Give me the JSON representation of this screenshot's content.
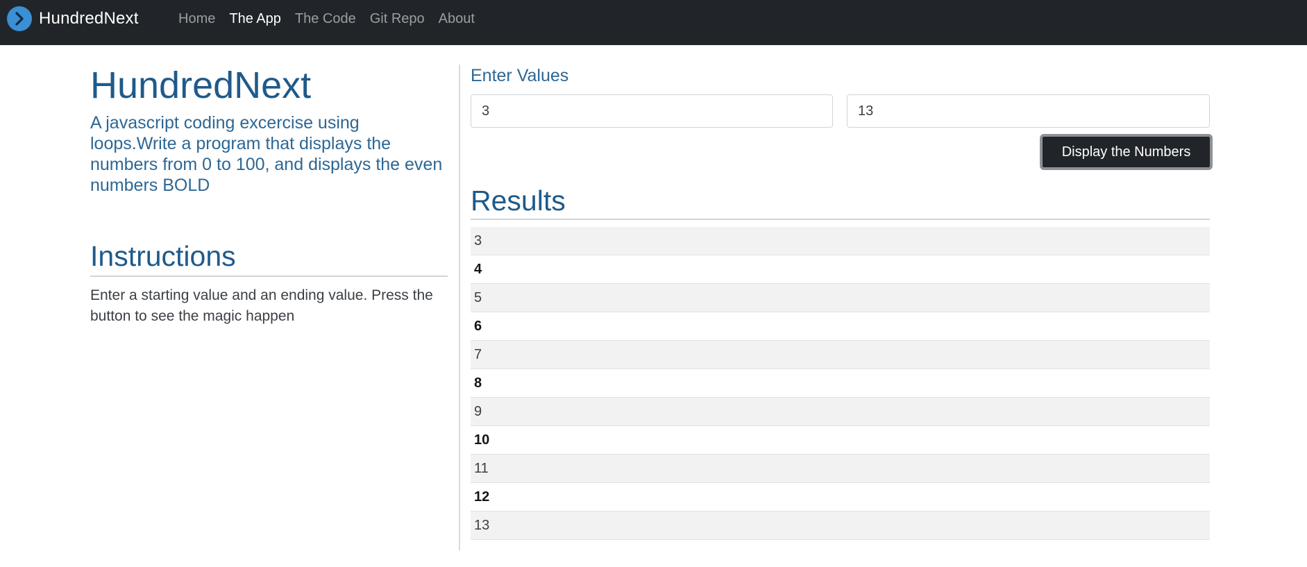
{
  "navbar": {
    "brand": "HundredNext",
    "links": [
      {
        "label": "Home",
        "active": false
      },
      {
        "label": "The App",
        "active": true
      },
      {
        "label": "The Code",
        "active": false
      },
      {
        "label": "Git Repo",
        "active": false
      },
      {
        "label": "About",
        "active": false
      }
    ]
  },
  "intro": {
    "title": "HundredNext",
    "description": "A javascript coding excercise using loops.Write a program that displays the numbers from 0 to 100, and displays the even numbers BOLD"
  },
  "instructions": {
    "title": "Instructions",
    "text": "Enter a starting value and an ending value. Press the button to see the magic happen"
  },
  "form": {
    "label": "Enter Values",
    "start_value": "3",
    "end_value": "13",
    "button_label": "Display the Numbers"
  },
  "results": {
    "title": "Results",
    "rows": [
      "3",
      "4",
      "5",
      "6",
      "7",
      "8",
      "9",
      "10",
      "11",
      "12",
      "13"
    ]
  },
  "colors": {
    "navbar_bg": "#212529",
    "heading_blue": "#1f5a8a",
    "logo_blue": "#3b8fd4",
    "button_bg": "#212529"
  },
  "icons": {
    "brand_logo": "chevron-right-circle-icon"
  }
}
